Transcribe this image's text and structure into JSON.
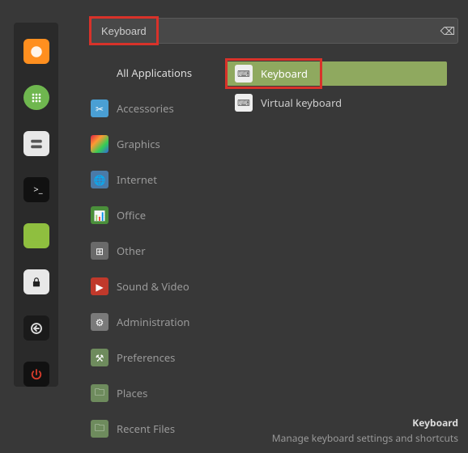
{
  "search": {
    "value": "Keyboard"
  },
  "sidebar": {
    "items": [
      {
        "name": "firefox",
        "glyph": "⬭"
      },
      {
        "name": "apps",
        "glyph": "⋮⋮⋮"
      },
      {
        "name": "files",
        "glyph": "☰"
      },
      {
        "name": "terminal",
        "glyph": ">_"
      },
      {
        "name": "folder",
        "glyph": "🗀"
      },
      {
        "name": "lock",
        "glyph": "🔒"
      },
      {
        "name": "logout",
        "glyph": "↩"
      },
      {
        "name": "power",
        "glyph": "⏻"
      }
    ]
  },
  "categories": [
    {
      "label": "All Applications",
      "icon": ""
    },
    {
      "label": "Accessories",
      "icon": "✂"
    },
    {
      "label": "Graphics",
      "icon": "◧"
    },
    {
      "label": "Internet",
      "icon": "🌐"
    },
    {
      "label": "Office",
      "icon": "📊"
    },
    {
      "label": "Other",
      "icon": "⊞"
    },
    {
      "label": "Sound & Video",
      "icon": "▶"
    },
    {
      "label": "Administration",
      "icon": "⚙"
    },
    {
      "label": "Preferences",
      "icon": "⚒"
    },
    {
      "label": "Places",
      "icon": "🗀"
    },
    {
      "label": "Recent Files",
      "icon": "🗀"
    }
  ],
  "results": [
    {
      "label": "Keyboard",
      "selected": true,
      "icon": "⌨"
    },
    {
      "label": "Virtual keyboard",
      "selected": false,
      "icon": "⌨"
    }
  ],
  "footer": {
    "title": "Keyboard",
    "desc": "Manage keyboard settings and shortcuts"
  }
}
